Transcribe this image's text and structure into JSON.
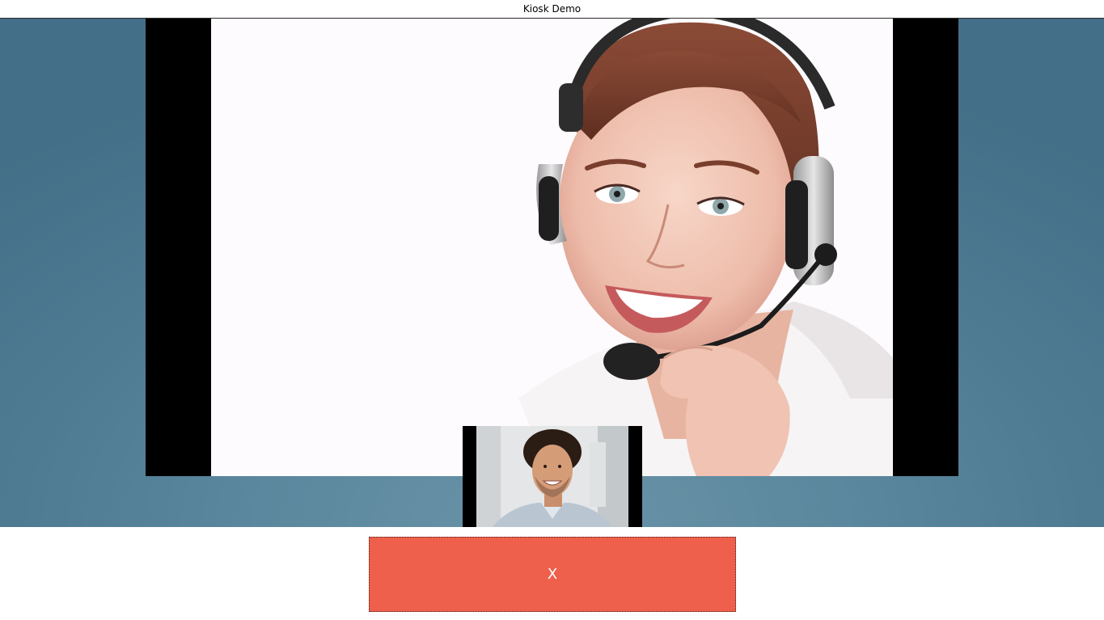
{
  "window": {
    "title": "Kiosk Demo"
  },
  "call": {
    "remote_video": {
      "description_icon": "agent-with-headset-photo"
    },
    "local_video": {
      "description_icon": "customer-selfie-photo"
    },
    "hangup_button": {
      "label": "X",
      "icon": "close-icon",
      "color": "#ee5f4c"
    }
  },
  "colors": {
    "background_accent": "#5b889e",
    "letterbox": "#000000",
    "hangup": "#ee5f4c"
  }
}
